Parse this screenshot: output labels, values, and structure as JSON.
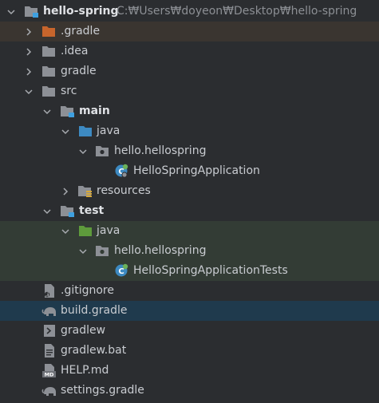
{
  "project": {
    "name": "hello-spring",
    "path": "C:₩Users₩doyeon₩Desktop₩hello-spring"
  },
  "items": {
    "gradle_dir": ".gradle",
    "idea_dir": ".idea",
    "gradle_folder": "gradle",
    "src": "src",
    "main": "main",
    "main_java": "java",
    "main_package": "hello.hellospring",
    "main_class": "HelloSpringApplication",
    "resources": "resources",
    "test": "test",
    "test_java": "java",
    "test_package": "hello.hellospring",
    "test_class": "HelloSpringApplicationTests",
    "gitignore": ".gitignore",
    "build_gradle": "build.gradle",
    "gradlew": "gradlew",
    "gradlew_bat": "gradlew.bat",
    "help_md": "HELP.md",
    "settings_gradle": "settings.gradle"
  },
  "colors": {
    "background": "#2b2d30",
    "selected_row": "#1f3a4d",
    "excluded_row": "#3a3530",
    "test_row": "#333c35",
    "folder_gray": "#8d9096",
    "folder_orange": "#c7652c",
    "folder_blue": "#3d8ac2",
    "folder_green": "#5e9b3c",
    "module_badge": "#3fa0e0",
    "spring_green": "#6bb15a"
  },
  "icons": {
    "expand": "chevron-down-icon",
    "collapse": "chevron-right-icon",
    "folder": "folder-icon",
    "module": "module-folder-icon",
    "package": "package-icon",
    "spring_class": "spring-class-icon",
    "gradle": "gradle-elephant-icon",
    "terminal": "terminal-script-icon",
    "markdown": "markdown-icon",
    "ignore": "gitignore-file-icon"
  }
}
